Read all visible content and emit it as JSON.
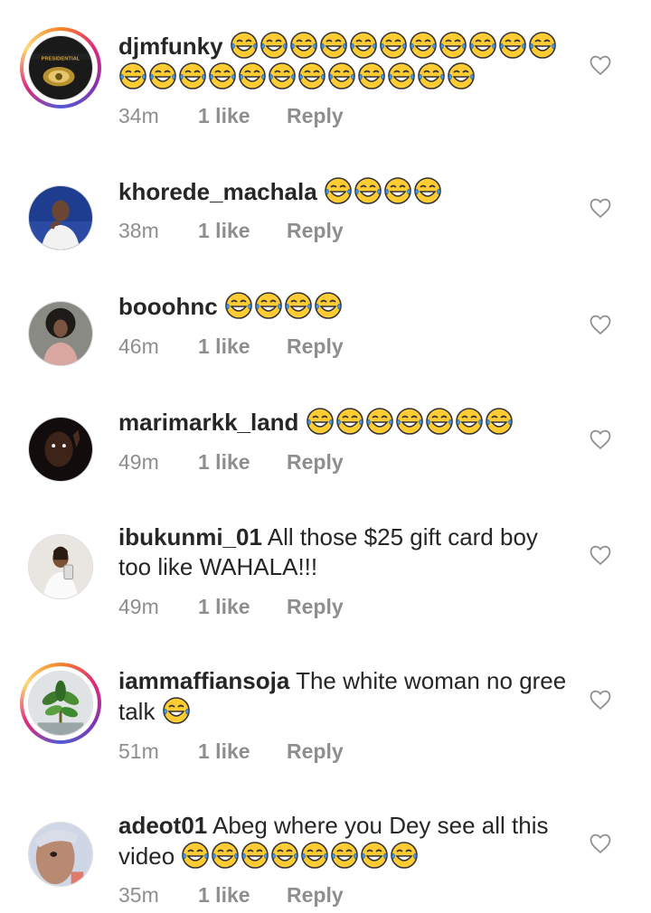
{
  "comments": [
    {
      "username": "djmfunky",
      "text": "",
      "emoji": "😂😂😂😂😂😂😂😂😂😂😂😂😂😂😂😂😂😂😂😂😂😂😂",
      "time": "34m",
      "likes": "1 like",
      "reply": "Reply",
      "story": true,
      "avatar": "album-cover"
    },
    {
      "username": "khorede_machala",
      "text": "",
      "emoji": "😂😂😂😂",
      "time": "38m",
      "likes": "1 like",
      "reply": "Reply",
      "story": false,
      "avatar": "man-white-shirt"
    },
    {
      "username": "booohnc",
      "text": "",
      "emoji": "😂😂😂😂",
      "time": "46m",
      "likes": "1 like",
      "reply": "Reply",
      "story": false,
      "avatar": "woman-afro"
    },
    {
      "username": "marimarkk_land",
      "text": "",
      "emoji": "😂😂😂😂😂😂😂",
      "time": "49m",
      "likes": "1 like",
      "reply": "Reply",
      "story": false,
      "avatar": "man-dark"
    },
    {
      "username": "ibukunmi_01",
      "text": "All those $25 gift card boy too like WAHALA!!!",
      "emoji": "",
      "time": "49m",
      "likes": "1 like",
      "reply": "Reply",
      "story": false,
      "avatar": "woman-selfie"
    },
    {
      "username": "iammaffiansoja",
      "text": "The white woman no gree talk",
      "emoji": "😂",
      "time": "51m",
      "likes": "1 like",
      "reply": "Reply",
      "story": true,
      "avatar": "plant"
    },
    {
      "username": "adeot01",
      "text": "Abeg where you Dey see all this video",
      "emoji": "😂😂😂😂😂😂😂😂",
      "time": "35m",
      "likes": "1 like",
      "reply": "Reply",
      "story": false,
      "avatar": "woman-closeup"
    }
  ],
  "colors": {
    "text": "#262626",
    "muted": "#8e8e8e",
    "background": "#ffffff"
  },
  "icons": {
    "like": "heart-outline-icon",
    "emoji": "face-with-tears-of-joy"
  }
}
